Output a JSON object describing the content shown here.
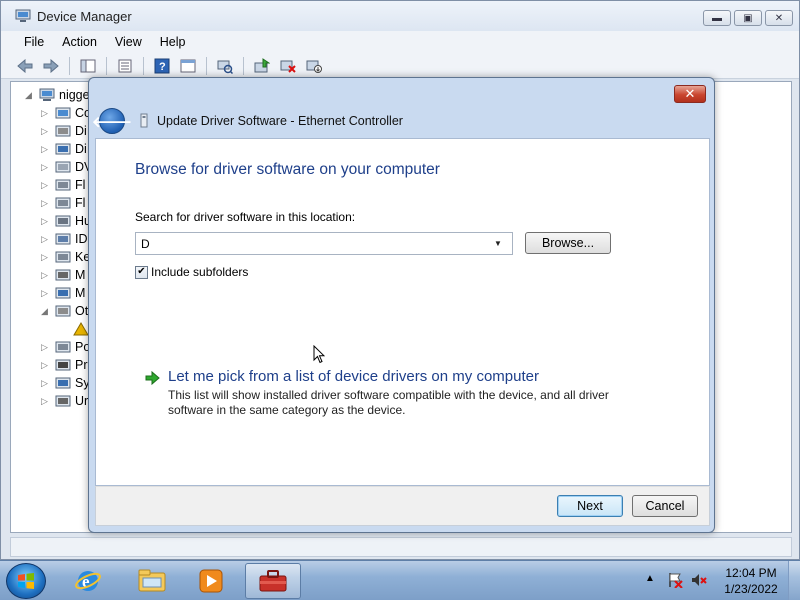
{
  "device_manager": {
    "title": "Device Manager",
    "menu": [
      "File",
      "Action",
      "View",
      "Help"
    ],
    "caption_buttons": {
      "minimize": "▬",
      "maximize": "▣",
      "close": "✕"
    },
    "tree": {
      "root_label": "nigge",
      "items": [
        {
          "label": "Co",
          "icon": "computer-icon"
        },
        {
          "label": "Di",
          "icon": "disk-drive-icon"
        },
        {
          "label": "Di",
          "icon": "display-adapter-icon"
        },
        {
          "label": "DV",
          "icon": "dvd-drive-icon"
        },
        {
          "label": "Fl",
          "icon": "floppy-controller-icon"
        },
        {
          "label": "Fl",
          "icon": "floppy-drive-icon"
        },
        {
          "label": "Hu",
          "icon": "human-interface-icon"
        },
        {
          "label": "ID",
          "icon": "ide-controller-icon"
        },
        {
          "label": "Ke",
          "icon": "keyboard-icon"
        },
        {
          "label": "M",
          "icon": "mouse-icon"
        },
        {
          "label": "M",
          "icon": "monitor-icon"
        },
        {
          "label": "Ot",
          "icon": "other-devices-icon"
        },
        {
          "label": "",
          "icon": "warning-device-icon"
        },
        {
          "label": "Po",
          "icon": "port-icon"
        },
        {
          "label": "Pr",
          "icon": "processor-icon"
        },
        {
          "label": "Sy",
          "icon": "system-device-icon"
        },
        {
          "label": "Ur",
          "icon": "usb-controller-icon"
        }
      ]
    }
  },
  "dialog": {
    "title": "Update Driver Software - Ethernet Controller",
    "close_label": "✕",
    "heading": "Browse for driver software on your computer",
    "search_label": "Search for driver software in this location:",
    "path_value": "D",
    "browse_label": "Browse...",
    "include_subfolders_label": "Include subfolders",
    "include_subfolders_checked": true,
    "pick_title": "Let me pick from a list of device drivers on my computer",
    "pick_description": "This list will show installed driver software compatible with the device, and all driver software in the same category as the device.",
    "next_label": "Next",
    "cancel_label": "Cancel"
  },
  "taskbar": {
    "buttons": [
      "internet-explorer-icon",
      "windows-explorer-icon",
      "media-player-icon",
      "device-manager-icon"
    ],
    "active_button": "device-manager-icon",
    "clock_time": "12:04 PM",
    "clock_date": "1/23/2022"
  }
}
